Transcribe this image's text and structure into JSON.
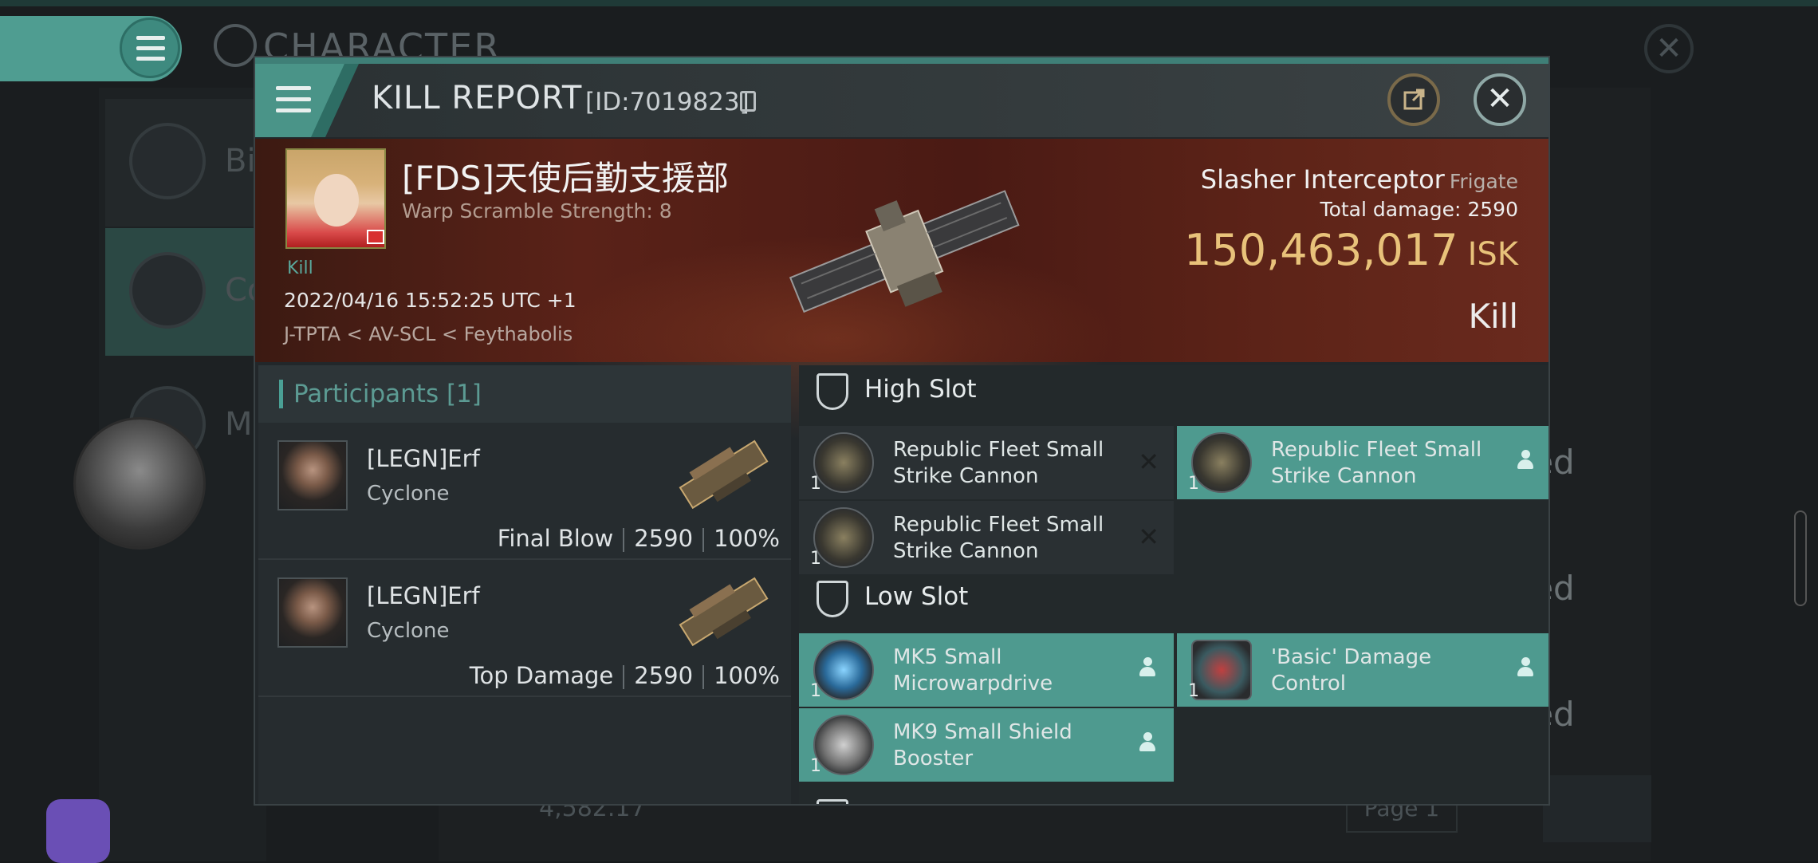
{
  "background": {
    "title": "CHARACTER",
    "sidebar_items": [
      "Bi",
      "Co",
      "M"
    ],
    "rows_text": [
      "ated",
      "ated",
      "ated"
    ],
    "footer_value": "4,582.17",
    "page_label": "Page 1"
  },
  "dialog": {
    "title": "KILL REPORT",
    "id_text": "[ID:7019823]",
    "victim": {
      "name": "[FDS]天使后勤支援部",
      "warp": "Warp Scramble Strength: 8",
      "tag": "Kill",
      "time": "2022/04/16 15:52:25 UTC +1",
      "location": "J-TPTA < AV-SCL < Feythabolis"
    },
    "ship": {
      "name": "Slasher Interceptor",
      "class": "Frigate",
      "damage_label": "Total damage:",
      "damage_value": "2590",
      "isk_value": "150,463,017",
      "isk_unit": "ISK",
      "result": "Kill"
    },
    "participants": {
      "title": "Participants [1]",
      "rows": [
        {
          "name": "[LEGN]Erf",
          "ship": "Cyclone",
          "role": "Final Blow",
          "damage": "2590",
          "percent": "100%"
        },
        {
          "name": "[LEGN]Erf",
          "ship": "Cyclone",
          "role": "Top Damage",
          "damage": "2590",
          "percent": "100%"
        }
      ]
    },
    "slots": {
      "high_title": "High Slot",
      "high": [
        {
          "qty": "1",
          "name": "Republic Fleet Small Strike Cannon",
          "state": "destroyed"
        },
        {
          "qty": "1",
          "name": "Republic Fleet Small Strike Cannon",
          "state": "dropped"
        },
        {
          "qty": "1",
          "name": "Republic Fleet Small Strike Cannon",
          "state": "destroyed"
        }
      ],
      "low_title": "Low Slot",
      "low": [
        {
          "qty": "1",
          "name": "MK5 Small Microwarpdrive",
          "state": "dropped"
        },
        {
          "qty": "1",
          "name": "'Basic' Damage Control",
          "state": "dropped"
        },
        {
          "qty": "1",
          "name": "MK9 Small Shield Booster",
          "state": "dropped"
        }
      ],
      "destroyed_mark": "✕"
    },
    "colors": {
      "accent": "#4e9a8f",
      "isk": "#e8c27a",
      "banner": "#5a2218"
    }
  }
}
